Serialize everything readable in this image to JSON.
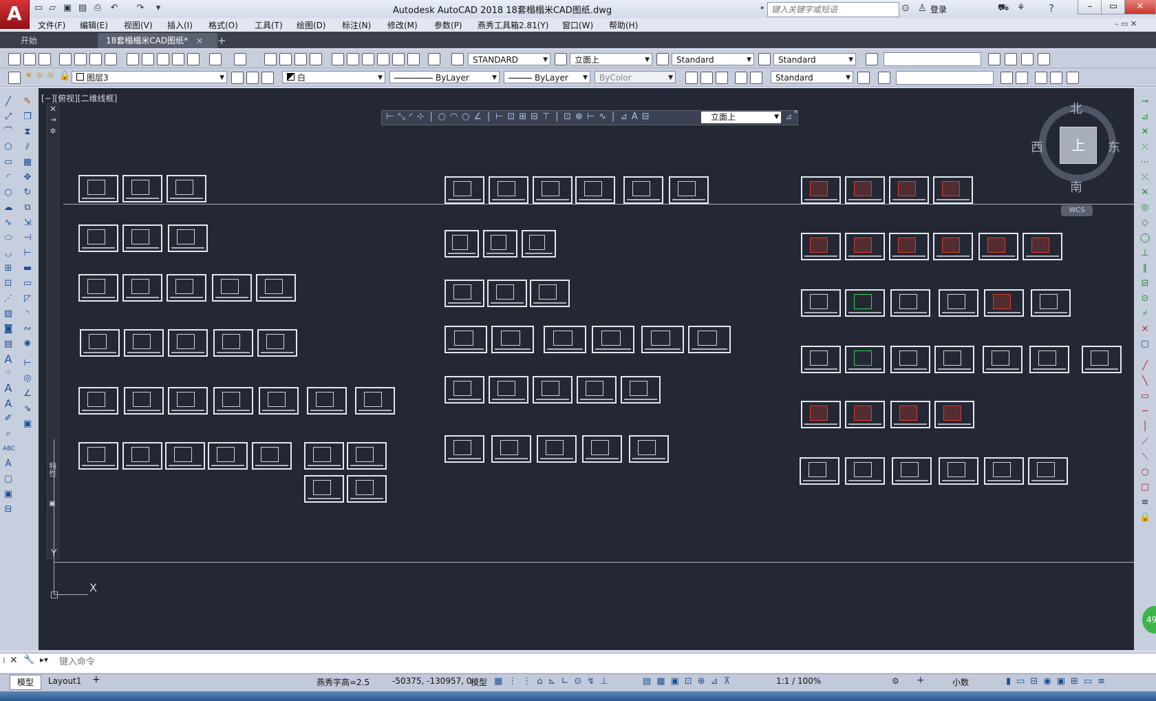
{
  "app": {
    "logo_letter": "A",
    "title": "Autodesk AutoCAD 2018    18套榻榻米CAD图纸.dwg",
    "search_placeholder": "键入关键字或短语",
    "login": "登录"
  },
  "menu": [
    "文件(F)",
    "编辑(E)",
    "视图(V)",
    "插入(I)",
    "格式(O)",
    "工具(T)",
    "绘图(D)",
    "标注(N)",
    "修改(M)",
    "参数(P)",
    "燕秀工具箱2.81(Y)",
    "窗口(W)",
    "帮助(H)"
  ],
  "tabs": {
    "start": "开始",
    "drawing": "18套榻榻米CAD图纸*",
    "close": "×",
    "add": "+"
  },
  "toolbar1": {
    "text_style": "STANDARD",
    "dim_style": "立面上",
    "table_style": "Standard",
    "mleader_style": "Standard"
  },
  "toolbar2": {
    "layer": "图层3",
    "color": "白",
    "linetype": "ByLayer",
    "lineweight": "ByLayer",
    "plotstyle": "ByColor",
    "style": "Standard"
  },
  "float_toolbar": {
    "dim_style": "立面上"
  },
  "viewport_label": "[−][俯视][二维线框]",
  "viewcube": {
    "north": "北",
    "south": "南",
    "east": "东",
    "west": "西",
    "face": "上",
    "wcs": "WCS"
  },
  "ucs": {
    "y": "Y",
    "x": "X"
  },
  "palette_label": "特性",
  "command": {
    "placeholder": "键入命令"
  },
  "layout_tabs": [
    "模型",
    "Layout1"
  ],
  "status": {
    "font_height": "燕秀字高=2.5",
    "coords": "-50375, -130957, 0",
    "space": "模型",
    "scale": "1:1 / 100%",
    "units": "小数",
    "badge": "49"
  },
  "colors": {
    "canvas": "#232834",
    "accent_red": "#c8252c",
    "ribbon": "#c7cfdf"
  }
}
